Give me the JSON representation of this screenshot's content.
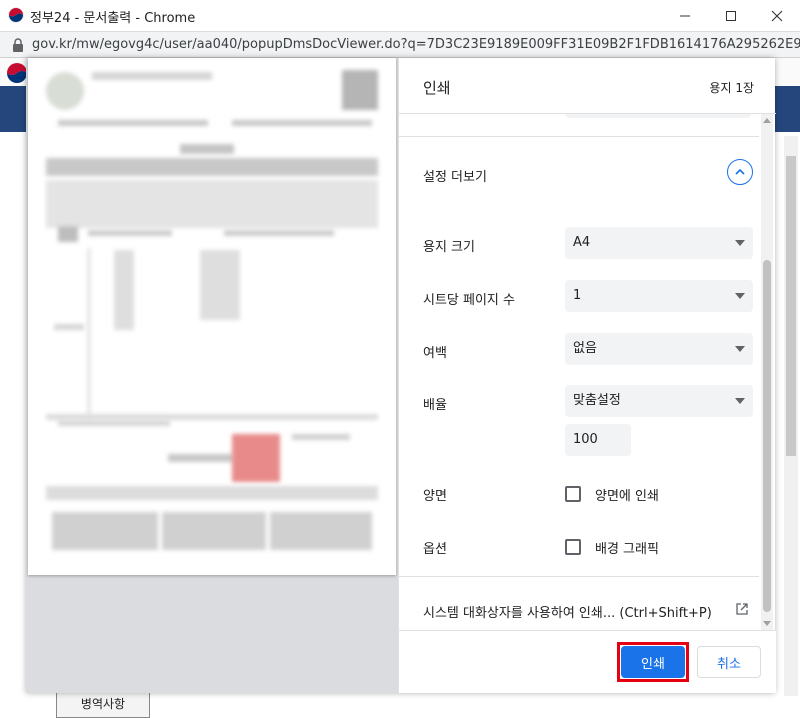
{
  "window": {
    "title": "정부24 - 문서출력 - Chrome",
    "url": "gov.kr/mw/egovg4c/user/aa040/popupDmsDocViewer.do?q=7D3C23E9189E009FF31E09B2F1FDB1614176A295262E9E;..."
  },
  "background_page": {
    "tab_label": "병역사항"
  },
  "print_dialog": {
    "title": "인쇄",
    "sheet_count": "용지 1장",
    "more_settings_label": "설정 더보기",
    "paper_size": {
      "label": "용지 크기",
      "value": "A4"
    },
    "pages_per_sheet": {
      "label": "시트당 페이지 수",
      "value": "1"
    },
    "margins": {
      "label": "여백",
      "value": "없음"
    },
    "scale": {
      "label": "배율",
      "value": "맞춤설정",
      "custom_value": "100"
    },
    "two_sided": {
      "label": "양면",
      "option_label": "양면에 인쇄",
      "checked": false
    },
    "options": {
      "label": "옵션",
      "option_label": "배경 그래픽",
      "checked": false
    },
    "system_dialog_label": "시스템 대화상자를 사용하여 인쇄... (Ctrl+Shift+P)",
    "print_button": "인쇄",
    "cancel_button": "취소"
  },
  "colors": {
    "accent": "#1a73e8",
    "highlight_outline": "#e60012",
    "nav_bar": "#25467d"
  }
}
